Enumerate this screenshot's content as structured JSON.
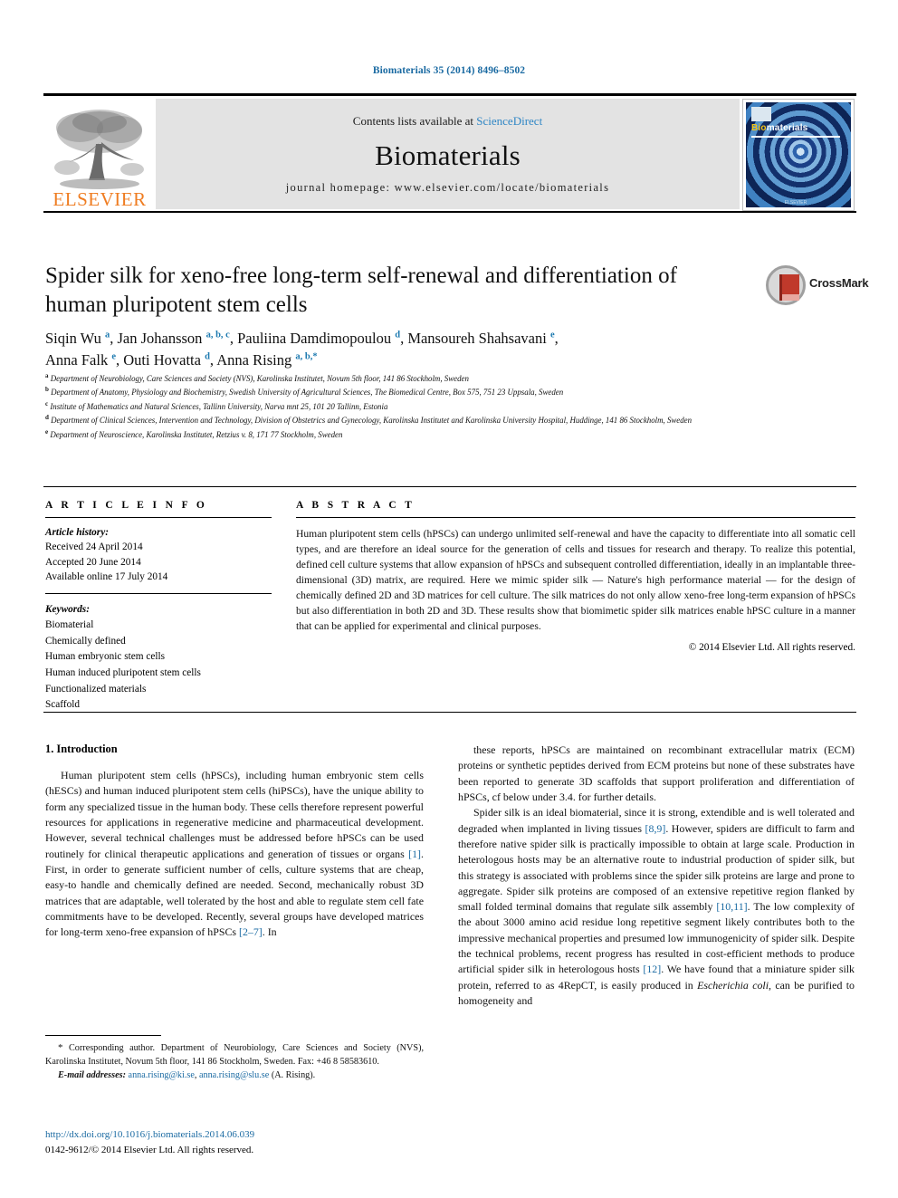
{
  "running_head": "Biomaterials 35 (2014) 8496–8502",
  "masthead": {
    "contents_prefix": "Contents lists available at ",
    "sciencedirect": "ScienceDirect",
    "journal_name": "Biomaterials",
    "homepage": "journal homepage: www.elsevier.com/locate/biomaterials",
    "publisher_logo_text": "ELSEVIER",
    "cover_title_bio": "Bio",
    "cover_title_rest": "materials",
    "cover_footer": "ELSEVIER"
  },
  "article": {
    "title": "Spider silk for xeno-free long-term self-renewal and differentiation of human pluripotent stem cells",
    "crossmark_label": "CrossMark",
    "authors_line1_html": "Siqin Wu <sup>a</sup>, Jan Johansson <sup>a, b, c</sup>, Pauliina Damdimopoulou <sup>d</sup>, Mansoureh Shahsavani <sup>e</sup>,",
    "authors_line2_html": "Anna Falk <sup>e</sup>, Outi Hovatta <sup>d</sup>, Anna Rising <sup>a, b,</sup><sup>*</sup>",
    "affiliations": [
      {
        "mark": "a",
        "text": "Department of Neurobiology, Care Sciences and Society (NVS), Karolinska Institutet, Novum 5th floor, 141 86 Stockholm, Sweden"
      },
      {
        "mark": "b",
        "text": "Department of Anatomy, Physiology and Biochemistry, Swedish University of Agricultural Sciences, The Biomedical Centre, Box 575, 751 23 Uppsala, Sweden"
      },
      {
        "mark": "c",
        "text": "Institute of Mathematics and Natural Sciences, Tallinn University, Narva mnt 25, 101 20 Tallinn, Estonia"
      },
      {
        "mark": "d",
        "text": "Department of Clinical Sciences, Intervention and Technology, Division of Obstetrics and Gynecology, Karolinska Institutet and Karolinska University Hospital, Huddinge, 141 86 Stockholm, Sweden"
      },
      {
        "mark": "e",
        "text": "Department of Neuroscience, Karolinska Institutet, Retzius v. 8, 171 77 Stockholm, Sweden"
      }
    ]
  },
  "article_info": {
    "heading": "A R T I C L E   I N F O",
    "history_label": "Article history:",
    "history": [
      "Received 24 April 2014",
      "Accepted 20 June 2014",
      "Available online 17 July 2014"
    ],
    "keywords_label": "Keywords:",
    "keywords": [
      "Biomaterial",
      "Chemically defined",
      "Human embryonic stem cells",
      "Human induced pluripotent stem cells",
      "Functionalized materials",
      "Scaffold"
    ]
  },
  "abstract": {
    "heading": "A B S T R A C T",
    "text": "Human pluripotent stem cells (hPSCs) can undergo unlimited self-renewal and have the capacity to differentiate into all somatic cell types, and are therefore an ideal source for the generation of cells and tissues for research and therapy. To realize this potential, defined cell culture systems that allow expansion of hPSCs and subsequent controlled differentiation, ideally in an implantable three-dimensional (3D) matrix, are required. Here we mimic spider silk — Nature's high performance material — for the design of chemically defined 2D and 3D matrices for cell culture. The silk matrices do not only allow xeno-free long-term expansion of hPSCs but also differentiation in both 2D and 3D. These results show that biomimetic spider silk matrices enable hPSC culture in a manner that can be applied for experimental and clinical purposes.",
    "copyright": "© 2014 Elsevier Ltd. All rights reserved."
  },
  "body": {
    "section_heading": "1. Introduction",
    "left_paragraphs": [
      "Human pluripotent stem cells (hPSCs), including human embryonic stem cells (hESCs) and human induced pluripotent stem cells (hiPSCs), have the unique ability to form any specialized tissue in the human body. These cells therefore represent powerful resources for applications in regenerative medicine and pharmaceutical development. However, several technical challenges must be addressed before hPSCs can be used routinely for clinical therapeutic applications and generation of tissues or organs [1]. First, in order to generate sufficient number of cells, culture systems that are cheap, easy-to handle and chemically defined are needed. Second, mechanically robust 3D matrices that are adaptable, well tolerated by the host and able to regulate stem cell fate commitments have to be developed. Recently, several groups have developed matrices for long-term xeno-free expansion of hPSCs [2–7]. In"
    ],
    "right_paragraphs": [
      "these reports, hPSCs are maintained on recombinant extracellular matrix (ECM) proteins or synthetic peptides derived from ECM proteins but none of these substrates have been reported to generate 3D scaffolds that support proliferation and differentiation of hPSCs, cf below under 3.4. for further details.",
      "Spider silk is an ideal biomaterial, since it is strong, extendible and is well tolerated and degraded when implanted in living tissues [8,9]. However, spiders are difficult to farm and therefore native spider silk is practically impossible to obtain at large scale. Production in heterologous hosts may be an alternative route to industrial production of spider silk, but this strategy is associated with problems since the spider silk proteins are large and prone to aggregate. Spider silk proteins are composed of an extensive repetitive region flanked by small folded terminal domains that regulate silk assembly [10,11]. The low complexity of the about 3000 amino acid residue long repetitive segment likely contributes both to the impressive mechanical properties and presumed low immunogenicity of spider silk. Despite the technical problems, recent progress has resulted in cost-efficient methods to produce artificial spider silk in heterologous hosts [12]. We have found that a miniature spider silk protein, referred to as 4RepCT, is easily produced in Escherichia coli, can be purified to homogeneity and"
    ],
    "inline_refs_left": [
      "[1]",
      "[2–7]"
    ],
    "inline_refs_right": [
      "[8,9]",
      "[10,11]",
      "[12]"
    ]
  },
  "footnotes": {
    "corresponding": "Corresponding author. Department of Neurobiology, Care Sciences and Society (NVS), Karolinska Institutet, Novum 5th floor, 141 86 Stockholm, Sweden. Fax: +46 8 58583610.",
    "email_label": "E-mail addresses:",
    "email1": "anna.rising@ki.se",
    "email2": "anna.rising@slu.se",
    "email_suffix": "(A. Rising).",
    "doi": "http://dx.doi.org/10.1016/j.biomaterials.2014.06.039",
    "issn_line_prefix": "0142-9612/",
    "issn_line_rest": "© 2014 Elsevier Ltd. All rights reserved."
  },
  "colors": {
    "link_blue": "#1a6aa2",
    "sciencedirect_blue": "#2f86c5",
    "elsevier_orange": "#ef7d22",
    "crossmark_red": "#c0392b"
  }
}
